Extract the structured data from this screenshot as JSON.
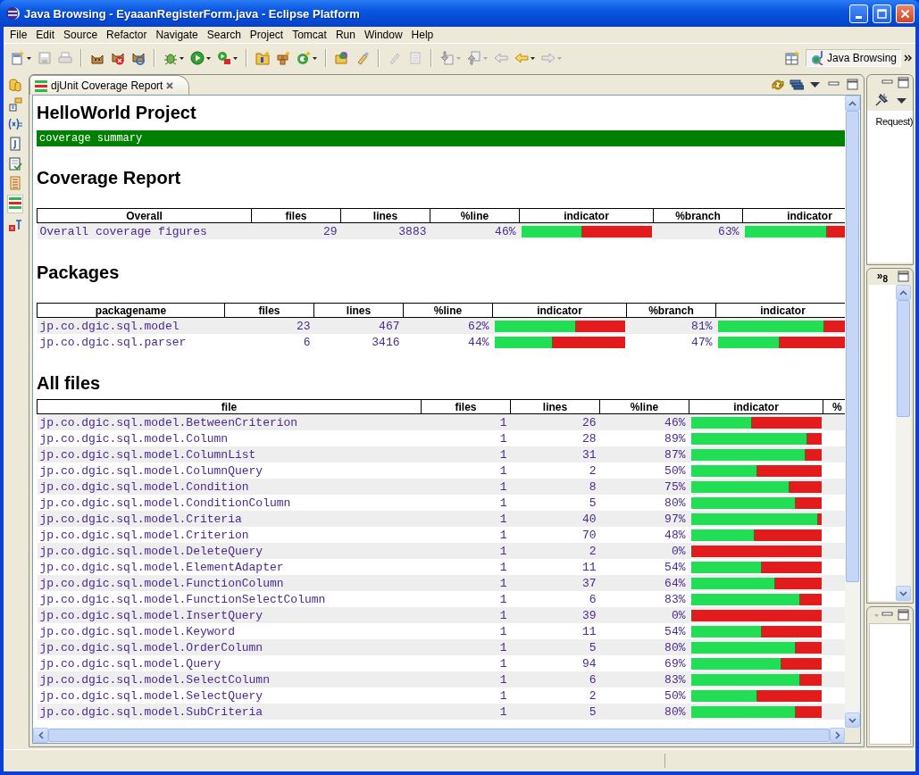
{
  "window": {
    "title": "Java Browsing - EyaaanRegisterForm.java - Eclipse Platform"
  },
  "menu": [
    {
      "label": "File"
    },
    {
      "label": "Edit"
    },
    {
      "label": "Source"
    },
    {
      "label": "Refactor"
    },
    {
      "label": "Navigate"
    },
    {
      "label": "Search"
    },
    {
      "label": "Project"
    },
    {
      "label": "Tomcat"
    },
    {
      "label": "Run"
    },
    {
      "label": "Window"
    },
    {
      "label": "Help"
    }
  ],
  "perspective": {
    "label": "Java Browsing",
    "selected": true
  },
  "editor": {
    "tab": {
      "label": "djUnit Coverage Report",
      "selected": true
    },
    "report": {
      "title": "HelloWorld Project",
      "summary_bar": "coverage summary",
      "overall": {
        "heading": "Coverage Report",
        "columns": [
          "Overall",
          "files",
          "lines",
          "%line",
          "indicator",
          "%branch",
          "indicator"
        ],
        "rows": [
          {
            "cells": [
              {
                "kind": "name",
                "text": "Overall coverage figures"
              },
              {
                "kind": "number",
                "text": "29"
              },
              {
                "kind": "number",
                "text": "3883"
              },
              {
                "kind": "number",
                "text": "46%"
              },
              {
                "kind": "bar",
                "level": 0.46
              },
              {
                "kind": "number",
                "text": "63%"
              },
              {
                "kind": "bar",
                "level": 0.63
              }
            ]
          }
        ]
      },
      "packages": {
        "heading": "Packages",
        "columns": [
          "packagename",
          "files",
          "lines",
          "%line",
          "indicator",
          "%branch",
          "indicator"
        ],
        "rows": [
          {
            "cells": [
              {
                "kind": "name",
                "text": "jp.co.dgic.sql.model"
              },
              {
                "kind": "number",
                "text": "23"
              },
              {
                "kind": "number",
                "text": "467"
              },
              {
                "kind": "number",
                "text": "62%"
              },
              {
                "kind": "bar",
                "level": 0.62
              },
              {
                "kind": "number",
                "text": "81%"
              },
              {
                "kind": "bar",
                "level": 0.81
              }
            ]
          },
          {
            "cells": [
              {
                "kind": "name",
                "text": "jp.co.dgic.sql.parser"
              },
              {
                "kind": "number",
                "text": "6"
              },
              {
                "kind": "number",
                "text": "3416"
              },
              {
                "kind": "number",
                "text": "44%"
              },
              {
                "kind": "bar",
                "level": 0.44
              },
              {
                "kind": "number",
                "text": "47%"
              },
              {
                "kind": "bar",
                "level": 0.47
              }
            ]
          }
        ]
      },
      "all_files": {
        "heading": "All files",
        "columns": [
          "file",
          "files",
          "lines",
          "%line",
          "indicator",
          "%"
        ],
        "rows": [
          {
            "cells": [
              {
                "kind": "name",
                "text": "jp.co.dgic.sql.model.BetweenCriterion"
              },
              {
                "kind": "number",
                "text": "1"
              },
              {
                "kind": "number",
                "text": "26"
              },
              {
                "kind": "number",
                "text": "46%"
              },
              {
                "kind": "bar",
                "level": 0.46
              }
            ]
          },
          {
            "cells": [
              {
                "kind": "name",
                "text": "jp.co.dgic.sql.model.Column"
              },
              {
                "kind": "number",
                "text": "1"
              },
              {
                "kind": "number",
                "text": "28"
              },
              {
                "kind": "number",
                "text": "89%"
              },
              {
                "kind": "bar",
                "level": 0.89
              }
            ]
          },
          {
            "cells": [
              {
                "kind": "name",
                "text": "jp.co.dgic.sql.model.ColumnList"
              },
              {
                "kind": "number",
                "text": "1"
              },
              {
                "kind": "number",
                "text": "31"
              },
              {
                "kind": "number",
                "text": "87%"
              },
              {
                "kind": "bar",
                "level": 0.87
              }
            ]
          },
          {
            "cells": [
              {
                "kind": "name",
                "text": "jp.co.dgic.sql.model.ColumnQuery"
              },
              {
                "kind": "number",
                "text": "1"
              },
              {
                "kind": "number",
                "text": "2"
              },
              {
                "kind": "number",
                "text": "50%"
              },
              {
                "kind": "bar",
                "level": 0.5
              }
            ]
          },
          {
            "cells": [
              {
                "kind": "name",
                "text": "jp.co.dgic.sql.model.Condition"
              },
              {
                "kind": "number",
                "text": "1"
              },
              {
                "kind": "number",
                "text": "8"
              },
              {
                "kind": "number",
                "text": "75%"
              },
              {
                "kind": "bar",
                "level": 0.75
              }
            ]
          },
          {
            "cells": [
              {
                "kind": "name",
                "text": "jp.co.dgic.sql.model.ConditionColumn"
              },
              {
                "kind": "number",
                "text": "1"
              },
              {
                "kind": "number",
                "text": "5"
              },
              {
                "kind": "number",
                "text": "80%"
              },
              {
                "kind": "bar",
                "level": 0.8
              }
            ]
          },
          {
            "cells": [
              {
                "kind": "name",
                "text": "jp.co.dgic.sql.model.Criteria"
              },
              {
                "kind": "number",
                "text": "1"
              },
              {
                "kind": "number",
                "text": "40"
              },
              {
                "kind": "number",
                "text": "97%"
              },
              {
                "kind": "bar",
                "level": 0.97
              }
            ]
          },
          {
            "cells": [
              {
                "kind": "name",
                "text": "jp.co.dgic.sql.model.Criterion"
              },
              {
                "kind": "number",
                "text": "1"
              },
              {
                "kind": "number",
                "text": "70"
              },
              {
                "kind": "number",
                "text": "48%"
              },
              {
                "kind": "bar",
                "level": 0.48
              }
            ]
          },
          {
            "cells": [
              {
                "kind": "name",
                "text": "jp.co.dgic.sql.model.DeleteQuery"
              },
              {
                "kind": "number",
                "text": "1"
              },
              {
                "kind": "number",
                "text": "2"
              },
              {
                "kind": "number",
                "text": "0%"
              },
              {
                "kind": "bar",
                "level": 0
              }
            ]
          },
          {
            "cells": [
              {
                "kind": "name",
                "text": "jp.co.dgic.sql.model.ElementAdapter"
              },
              {
                "kind": "number",
                "text": "1"
              },
              {
                "kind": "number",
                "text": "11"
              },
              {
                "kind": "number",
                "text": "54%"
              },
              {
                "kind": "bar",
                "level": 0.54
              }
            ]
          },
          {
            "cells": [
              {
                "kind": "name",
                "text": "jp.co.dgic.sql.model.FunctionColumn"
              },
              {
                "kind": "number",
                "text": "1"
              },
              {
                "kind": "number",
                "text": "37"
              },
              {
                "kind": "number",
                "text": "64%"
              },
              {
                "kind": "bar",
                "level": 0.64
              }
            ]
          },
          {
            "cells": [
              {
                "kind": "name",
                "text": "jp.co.dgic.sql.model.FunctionSelectColumn"
              },
              {
                "kind": "number",
                "text": "1"
              },
              {
                "kind": "number",
                "text": "6"
              },
              {
                "kind": "number",
                "text": "83%"
              },
              {
                "kind": "bar",
                "level": 0.83
              }
            ]
          },
          {
            "cells": [
              {
                "kind": "name",
                "text": "jp.co.dgic.sql.model.InsertQuery"
              },
              {
                "kind": "number",
                "text": "1"
              },
              {
                "kind": "number",
                "text": "39"
              },
              {
                "kind": "number",
                "text": "0%"
              },
              {
                "kind": "bar",
                "level": 0
              }
            ]
          },
          {
            "cells": [
              {
                "kind": "name",
                "text": "jp.co.dgic.sql.model.Keyword"
              },
              {
                "kind": "number",
                "text": "1"
              },
              {
                "kind": "number",
                "text": "11"
              },
              {
                "kind": "number",
                "text": "54%"
              },
              {
                "kind": "bar",
                "level": 0.54
              }
            ]
          },
          {
            "cells": [
              {
                "kind": "name",
                "text": "jp.co.dgic.sql.model.OrderColumn"
              },
              {
                "kind": "number",
                "text": "1"
              },
              {
                "kind": "number",
                "text": "5"
              },
              {
                "kind": "number",
                "text": "80%"
              },
              {
                "kind": "bar",
                "level": 0.8
              }
            ]
          },
          {
            "cells": [
              {
                "kind": "name",
                "text": "jp.co.dgic.sql.model.Query"
              },
              {
                "kind": "number",
                "text": "1"
              },
              {
                "kind": "number",
                "text": "94"
              },
              {
                "kind": "number",
                "text": "69%"
              },
              {
                "kind": "bar",
                "level": 0.69
              }
            ]
          },
          {
            "cells": [
              {
                "kind": "name",
                "text": "jp.co.dgic.sql.model.SelectColumn"
              },
              {
                "kind": "number",
                "text": "1"
              },
              {
                "kind": "number",
                "text": "6"
              },
              {
                "kind": "number",
                "text": "83%"
              },
              {
                "kind": "bar",
                "level": 0.83
              }
            ]
          },
          {
            "cells": [
              {
                "kind": "name",
                "text": "jp.co.dgic.sql.model.SelectQuery"
              },
              {
                "kind": "number",
                "text": "1"
              },
              {
                "kind": "number",
                "text": "2"
              },
              {
                "kind": "number",
                "text": "50%"
              },
              {
                "kind": "bar",
                "level": 0.5
              }
            ]
          },
          {
            "cells": [
              {
                "kind": "name",
                "text": "jp.co.dgic.sql.model.SubCriteria"
              },
              {
                "kind": "number",
                "text": "1"
              },
              {
                "kind": "number",
                "text": "5"
              },
              {
                "kind": "number",
                "text": "80%"
              },
              {
                "kind": "bar",
                "level": 0.8
              }
            ]
          }
        ]
      }
    }
  },
  "side_panels": {
    "top_text": "Request)",
    "overflow": "»$_{8}$"
  }
}
